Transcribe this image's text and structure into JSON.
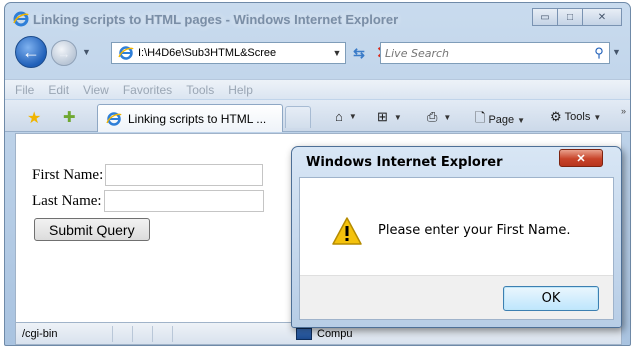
{
  "window": {
    "title": "Linking scripts to HTML pages - Windows Internet Explorer",
    "minimize_glyph": "▭",
    "maximize_glyph": "□",
    "close_glyph": "✕"
  },
  "address_bar": {
    "url": "I:\\H4D6e\\Sub3HTML&Scree"
  },
  "search": {
    "placeholder": "Live Search"
  },
  "menu": {
    "items": [
      "File",
      "Edit",
      "View",
      "Favorites",
      "Tools",
      "Help"
    ]
  },
  "tab": {
    "label": "Linking scripts to HTML ..."
  },
  "commands": {
    "page_label": "Page",
    "tools_label": "Tools"
  },
  "form": {
    "first_name_label": "First Name:",
    "last_name_label": "Last Name:",
    "submit_label": "Submit Query"
  },
  "status": {
    "text": "/cgi-bin",
    "zone": "Compu"
  },
  "dialog": {
    "title": "Windows Internet Explorer",
    "message": "Please enter your First Name.",
    "ok_label": "OK",
    "close_glyph": "✕"
  }
}
